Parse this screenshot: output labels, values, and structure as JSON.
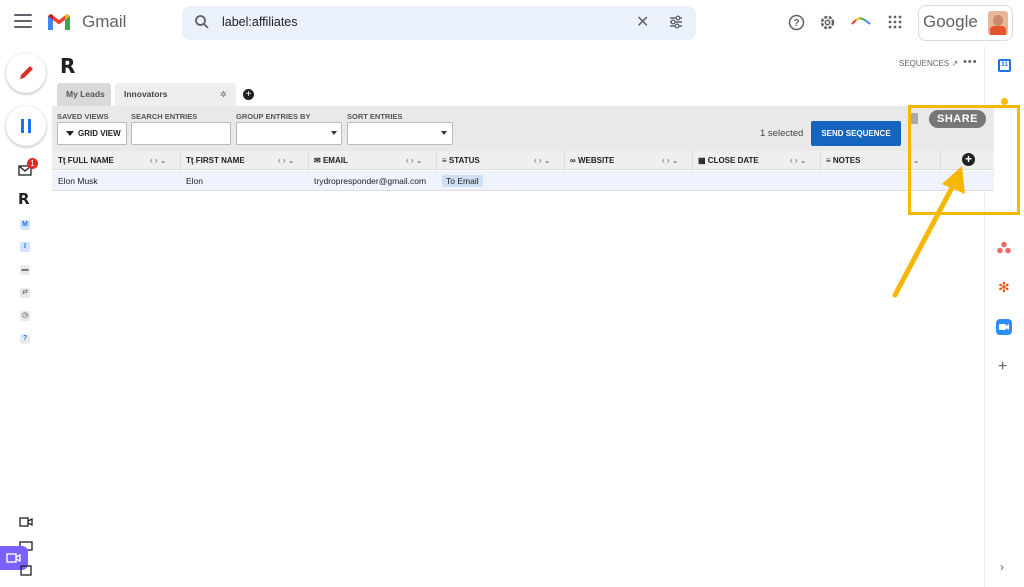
{
  "header": {
    "app_name": "Gmail",
    "search_value": "label:affiliates",
    "account_brand": "Google"
  },
  "left_rail": {
    "unread_badge": "1"
  },
  "extension": {
    "logo": "R",
    "sequences_link": "SEQUENCES ↗",
    "more": "•••",
    "tabs": [
      {
        "label": "My Leads"
      },
      {
        "label": "Innovators"
      }
    ],
    "toolbar": {
      "saved_views_label": "SAVED VIEWS",
      "grid_view": "GRID VIEW",
      "search_entries_label": "SEARCH ENTRIES",
      "group_entries_label": "GROUP ENTRIES BY",
      "sort_entries_label": "SORT ENTRIES",
      "selected_count": "1 selected",
      "send_sequence": "SEND SEQUENCE",
      "share": "SHARE"
    },
    "columns": [
      {
        "icon": "Tţ",
        "label": "FULL NAME"
      },
      {
        "icon": "Tţ",
        "label": "FIRST NAME"
      },
      {
        "icon": "✉",
        "label": "EMAIL"
      },
      {
        "icon": "≡",
        "label": "STATUS"
      },
      {
        "icon": "∞",
        "label": "WEBSITE"
      },
      {
        "icon": "▦",
        "label": "CLOSE DATE"
      },
      {
        "icon": "≡",
        "label": "NOTES"
      }
    ],
    "rows": [
      {
        "full_name": "Elon Musk",
        "first_name": "Elon",
        "email": "trydropresponder@gmail.com",
        "status": "To Email",
        "website": "",
        "close_date": "",
        "notes": ""
      }
    ]
  },
  "colors": {
    "accent_blue": "#1565c0",
    "highlight_yellow": "#f5b700",
    "meet_purple": "#7b61ff"
  }
}
